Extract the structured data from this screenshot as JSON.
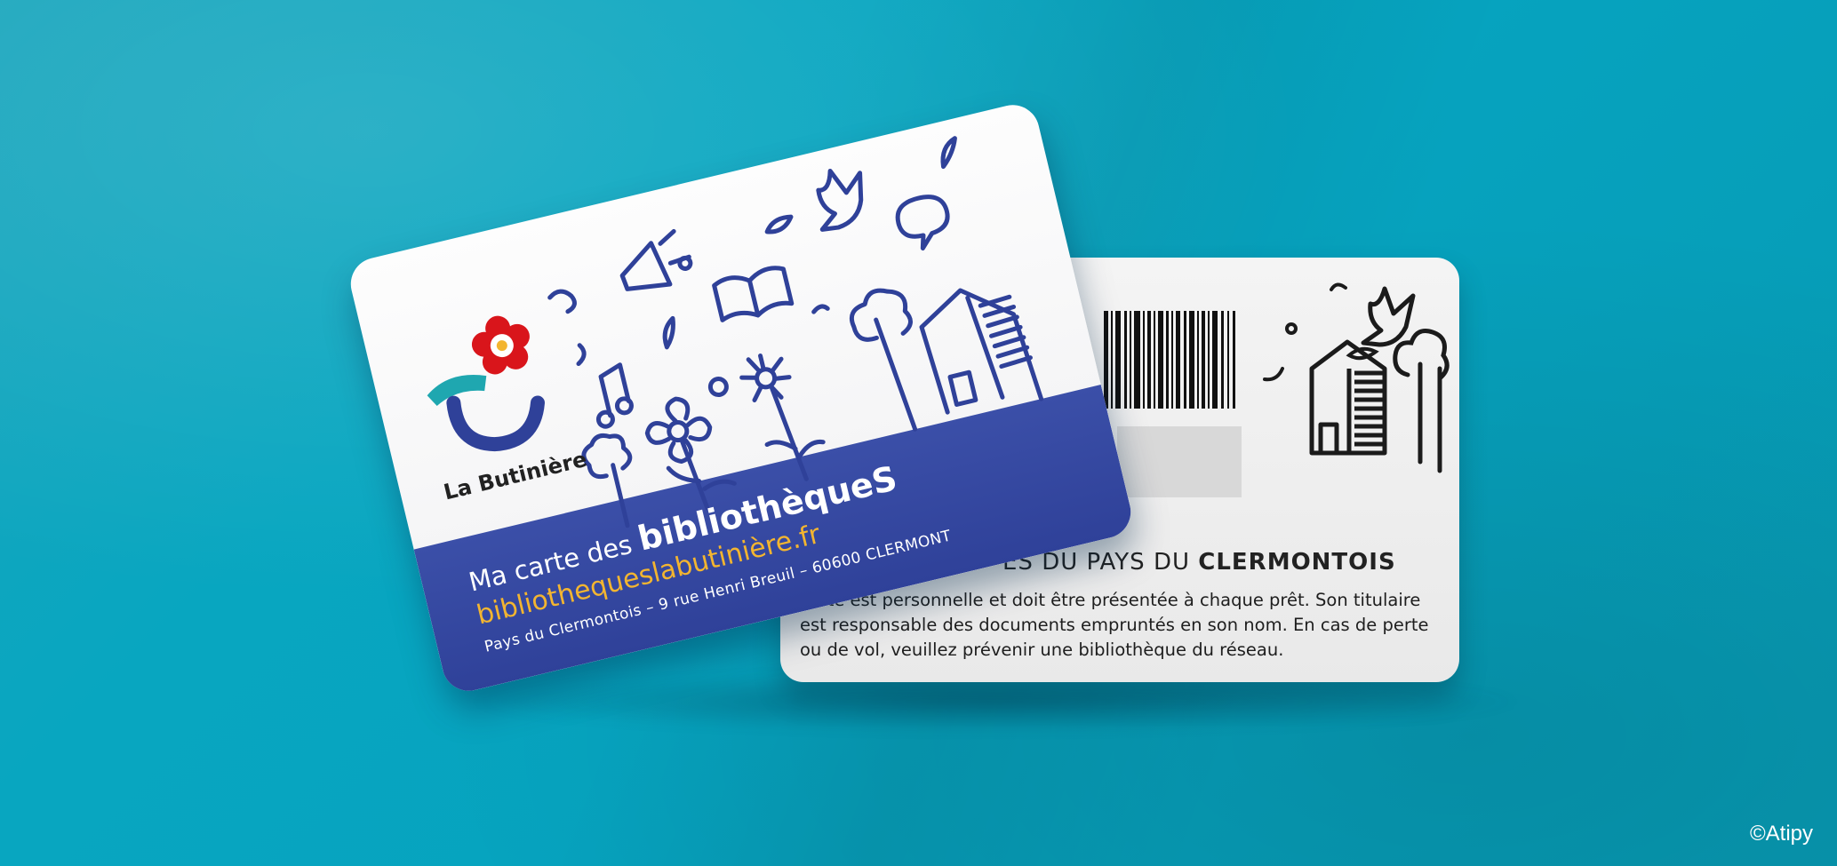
{
  "scene": {
    "background_color": "#07a4bf",
    "brand_blue": "#2f4199",
    "brand_yellow": "#f3b530",
    "brand_red": "#d9151b",
    "brand_teal": "#1fa7b0"
  },
  "front_card": {
    "logo_name": "La Butinière",
    "logo_icon": "flower-hook-logo-icon",
    "title_prefix": "Ma carte des ",
    "title_emphasis": "bibliothèqueS",
    "website": "bibliothequeslabutinière.fr",
    "address": "Pays du Clermontois – 9 rue Henri Breuil – 60600 CLERMONT",
    "illustrations": [
      "bird-icon",
      "megaphone-icon",
      "open-book-icon",
      "music-note-icon",
      "flower-icon",
      "tree-icon",
      "house-icon",
      "speech-bubble-icon",
      "leaf-icon"
    ]
  },
  "back_card": {
    "heading_light": "ES DU PAYS DU ",
    "heading_bold": "CLERMONTOIS",
    "body_text": "carte est personnelle et doit être présentée à chaque prêt. Son titulaire est responsable des documents empruntés en son nom. En cas de perte ou de vol, veuillez prévenir une bibliothèque du réseau.",
    "illustrations": [
      "barcode-icon",
      "bird-icon",
      "house-icon",
      "tree-icon"
    ]
  },
  "credit": "©Atipy"
}
